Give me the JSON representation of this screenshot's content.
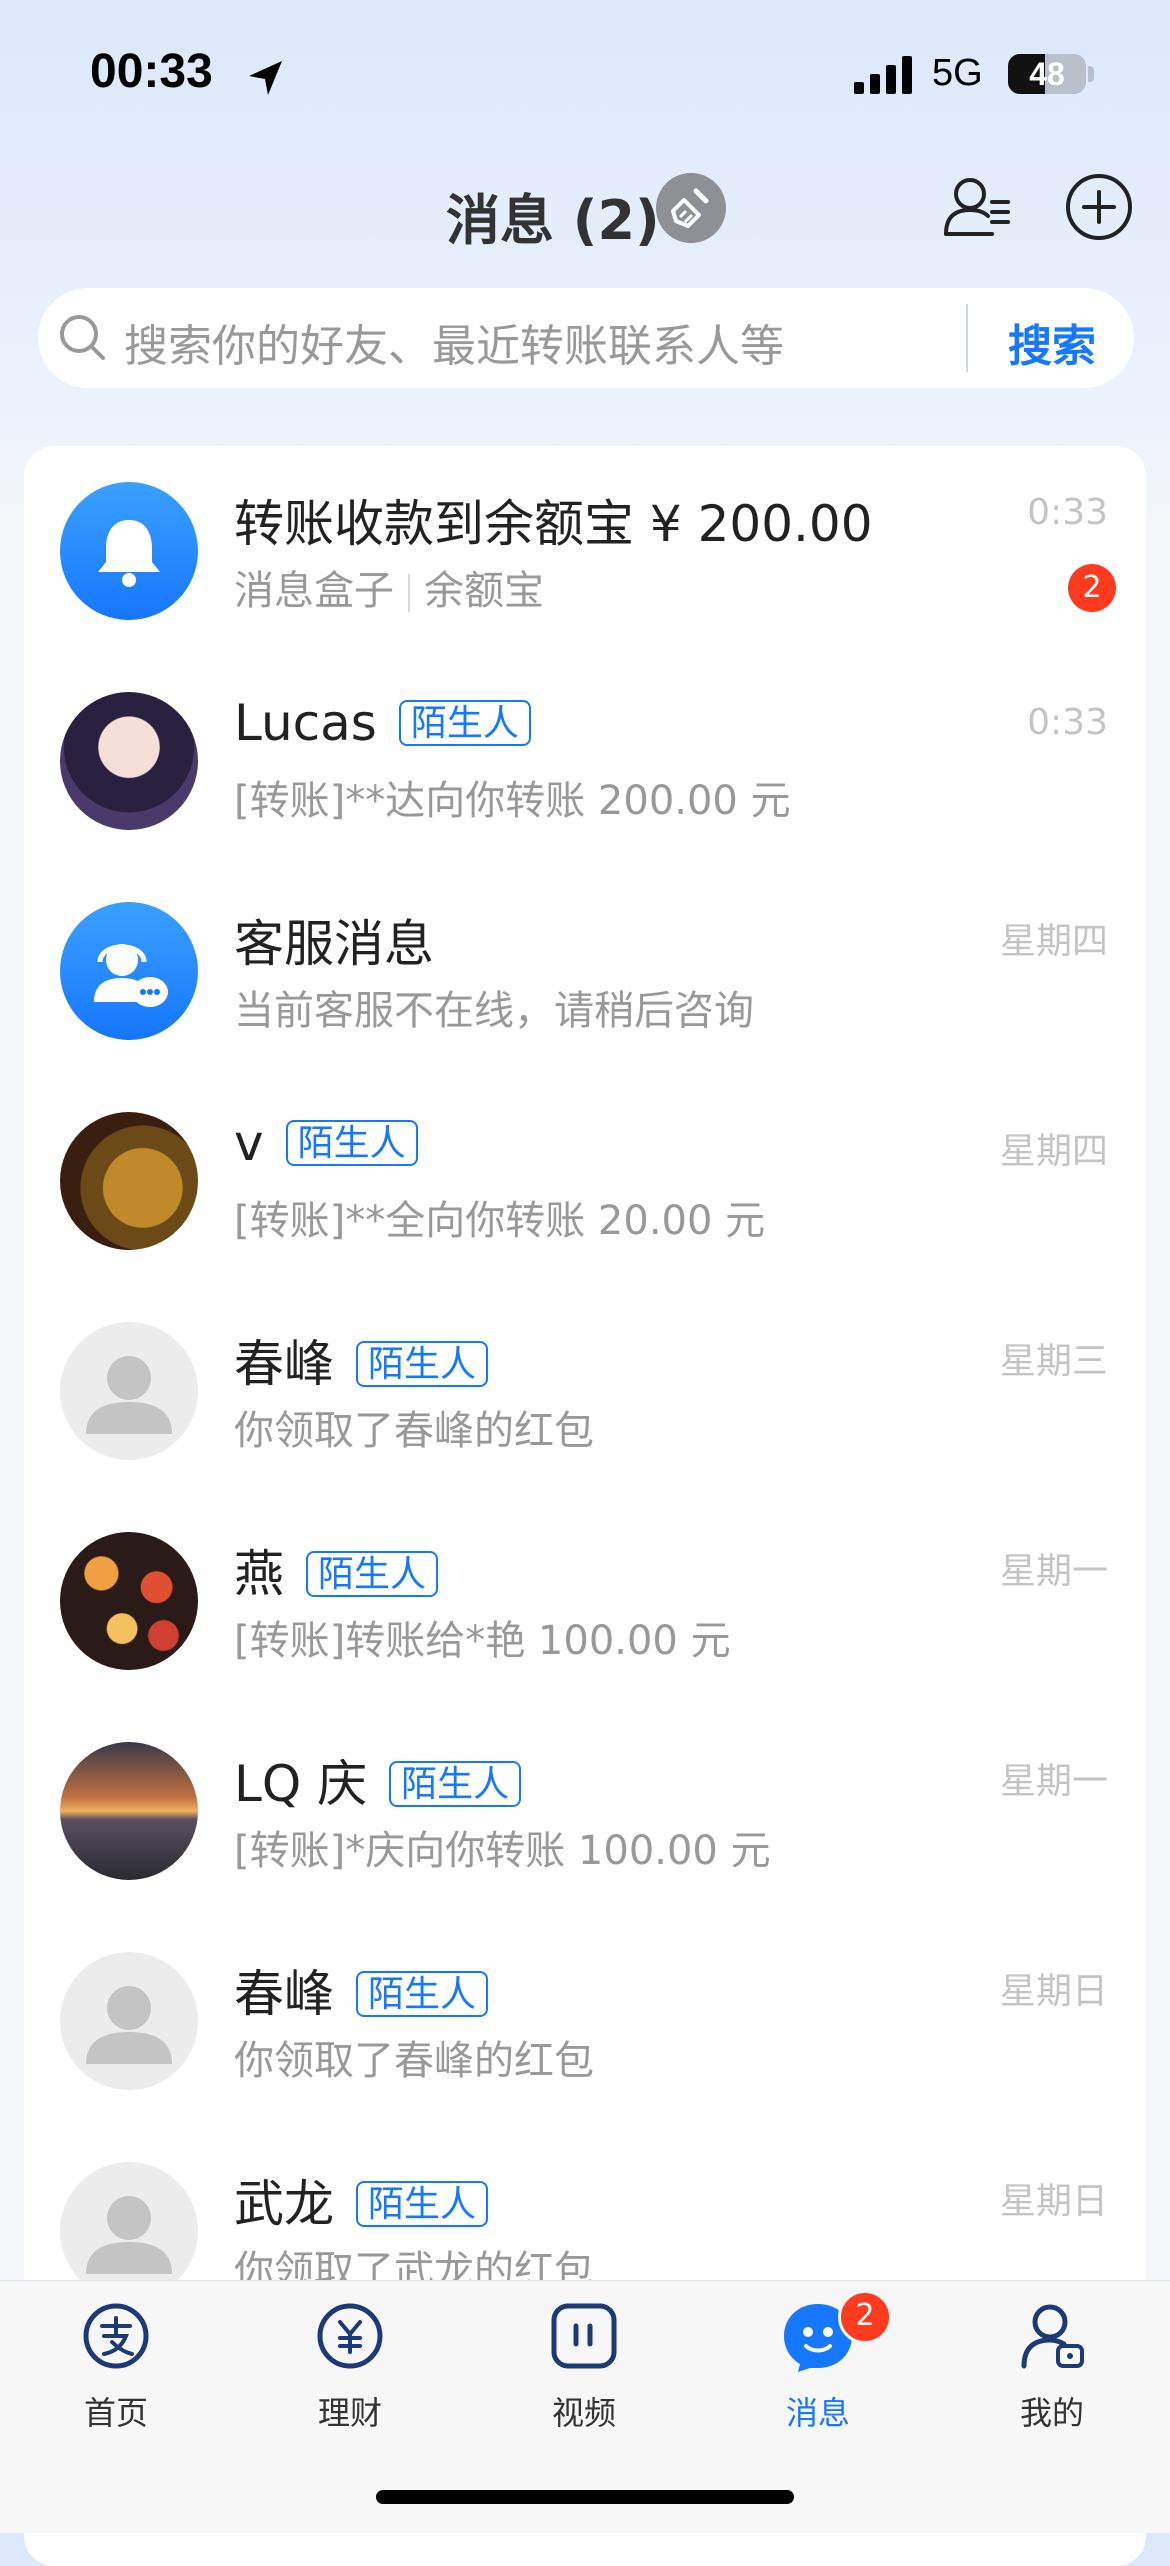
{
  "status_bar": {
    "time": "00:33",
    "network": "5G",
    "battery": "48",
    "battery_level": 0.48
  },
  "header": {
    "title": "消息 (2)"
  },
  "search": {
    "placeholder": "搜索你的好友、最近转账联系人等",
    "button": "搜索"
  },
  "messages": [
    {
      "name": "转账收款到余额宝 ¥ 200.00",
      "sub_a": "消息盒子",
      "sub_b": "余额宝",
      "time": "0:33",
      "badge": "2",
      "avatar": "bell-icon",
      "tag": ""
    },
    {
      "name": "Lucas",
      "tag": "陌生人",
      "sub": "[转账]**达向你转账 200.00 元",
      "time": "0:33",
      "avatar": "anime-avatar"
    },
    {
      "name": "客服消息",
      "tag": "",
      "sub": "当前客服不在线，请稍后咨询",
      "time": "星期四",
      "avatar": "customer-service-icon"
    },
    {
      "name": "v",
      "tag": "陌生人",
      "sub": "[转账]**全向你转账 20.00 元",
      "time": "星期四",
      "avatar": "statue-avatar"
    },
    {
      "name": "春峰",
      "tag": "陌生人",
      "sub": "你领取了春峰的红包",
      "time": "星期三",
      "avatar": "default-avatar"
    },
    {
      "name": "燕",
      "tag": "陌生人",
      "sub": "[转账]转账给*艳 100.00 元",
      "time": "星期一",
      "avatar": "lanterns-avatar"
    },
    {
      "name": "LQ 庆",
      "tag": "陌生人",
      "sub": "[转账]*庆向你转账 100.00 元",
      "time": "星期一",
      "avatar": "sunset-avatar"
    },
    {
      "name": "春峰",
      "tag": "陌生人",
      "sub": "你领取了春峰的红包",
      "time": "星期日",
      "avatar": "default-avatar"
    },
    {
      "name": "武龙",
      "tag": "陌生人",
      "sub": "你领取了武龙的红包",
      "time": "星期日",
      "avatar": "default-avatar"
    }
  ],
  "tabbar": {
    "items": [
      {
        "label": "首页",
        "icon": "alipay-home-icon"
      },
      {
        "label": "理财",
        "icon": "yuan-icon"
      },
      {
        "label": "视频",
        "icon": "video-icon"
      },
      {
        "label": "消息",
        "icon": "message-icon",
        "badge": "2",
        "active": true
      },
      {
        "label": "我的",
        "icon": "profile-icon"
      }
    ]
  },
  "colors": {
    "accent": "#1677ff",
    "badge": "#ff3b1f"
  }
}
